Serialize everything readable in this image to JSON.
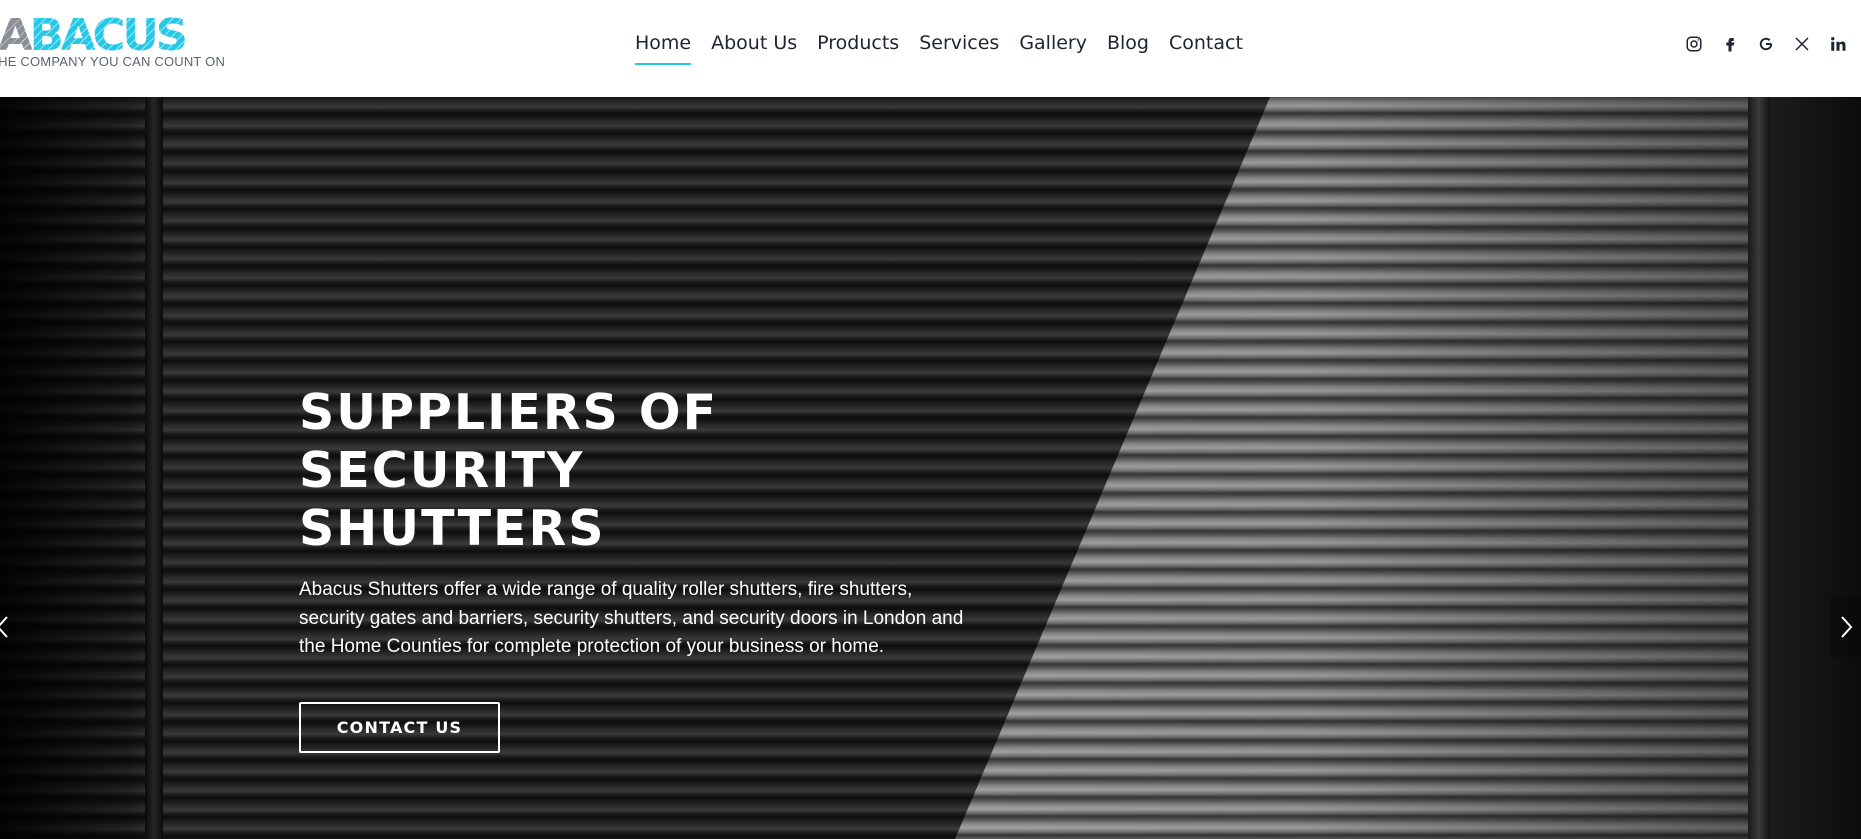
{
  "brand": {
    "logo_text": "ABACUS",
    "tagline": "THE COMPANY YOU CAN COUNT ON",
    "accent_color": "#27c7e6"
  },
  "nav": {
    "items": [
      {
        "label": "Home",
        "active": true
      },
      {
        "label": "About Us",
        "active": false
      },
      {
        "label": "Products",
        "active": false
      },
      {
        "label": "Services",
        "active": false
      },
      {
        "label": "Gallery",
        "active": false
      },
      {
        "label": "Blog",
        "active": false
      },
      {
        "label": "Contact",
        "active": false
      }
    ]
  },
  "social": [
    "instagram-icon",
    "facebook-icon",
    "google-icon",
    "x-icon",
    "linkedin-icon"
  ],
  "hero": {
    "title_line1": "SUPPLIERS OF SECURITY",
    "title_line2": "SHUTTERS",
    "description": "Abacus Shutters offer a wide range of quality roller shutters, fire shutters, security gates and barriers, security shutters, and security doors in London and the Home Counties for complete protection of your business or home.",
    "button_label": "CONTACT US"
  },
  "slider": {
    "prev_icon": "chevron-left-icon",
    "next_icon": "chevron-right-icon"
  }
}
